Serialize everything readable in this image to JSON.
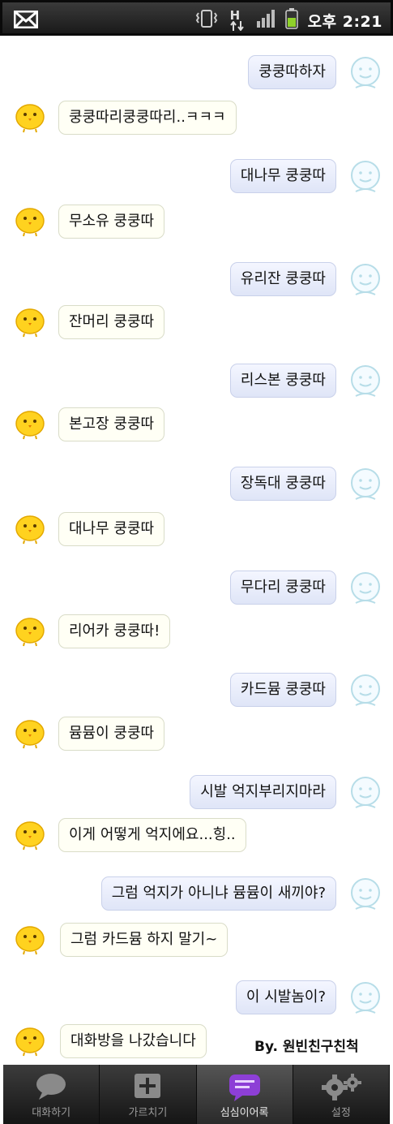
{
  "status_bar": {
    "ampm": "오후",
    "time": "2:21",
    "network": "H"
  },
  "messages": [
    {
      "from": "me",
      "text": "쿵쿵따하자"
    },
    {
      "from": "bot",
      "text": "쿵쿵따리쿵쿵따리..ㅋㅋㅋ"
    },
    {
      "from": "me",
      "text": "대나무 쿵쿵따"
    },
    {
      "from": "bot",
      "text": "무소유 쿵쿵따"
    },
    {
      "from": "me",
      "text": "유리잔 쿵쿵따"
    },
    {
      "from": "bot",
      "text": "잔머리 쿵쿵따"
    },
    {
      "from": "me",
      "text": "리스본 쿵쿵따"
    },
    {
      "from": "bot",
      "text": "본고장 쿵쿵따"
    },
    {
      "from": "me",
      "text": "장독대 쿵쿵따"
    },
    {
      "from": "bot",
      "text": "대나무 쿵쿵따"
    },
    {
      "from": "me",
      "text": "무다리 쿵쿵따"
    },
    {
      "from": "bot",
      "text": "리어카 쿵쿵따!"
    },
    {
      "from": "me",
      "text": "카드뮴 쿵쿵따"
    },
    {
      "from": "bot",
      "text": "뮴뮴이 쿵쿵따"
    },
    {
      "from": "me",
      "text": "시발 억지부리지마라"
    },
    {
      "from": "bot",
      "text": "이게 어떻게 억지에요...힝.."
    },
    {
      "from": "me",
      "text": "그럼 억지가 아니냐 뮴뮴이 새끼야?"
    },
    {
      "from": "bot",
      "text": "그럼 카드뮴 하지 말기~"
    },
    {
      "from": "me",
      "text": "이 시발놈이?"
    },
    {
      "from": "bot",
      "text": "대화방을 나갔습니다"
    }
  ],
  "credit": "By. 원빈친구친척",
  "tabs": [
    {
      "label": "대화하기",
      "icon": "speech-bubble-icon"
    },
    {
      "label": "가르치기",
      "icon": "plus-box-icon"
    },
    {
      "label": "심심이어록",
      "icon": "chat-bubble-purple-icon",
      "active": true
    },
    {
      "label": "설정",
      "icon": "gears-icon"
    }
  ],
  "colors": {
    "my_bubble": "#e6ebfa",
    "bot_bubble": "#fffff5",
    "tab_active_icon": "#8d3fd6",
    "status_bar": "#1f1f1f",
    "battery": "#8fd12a"
  }
}
